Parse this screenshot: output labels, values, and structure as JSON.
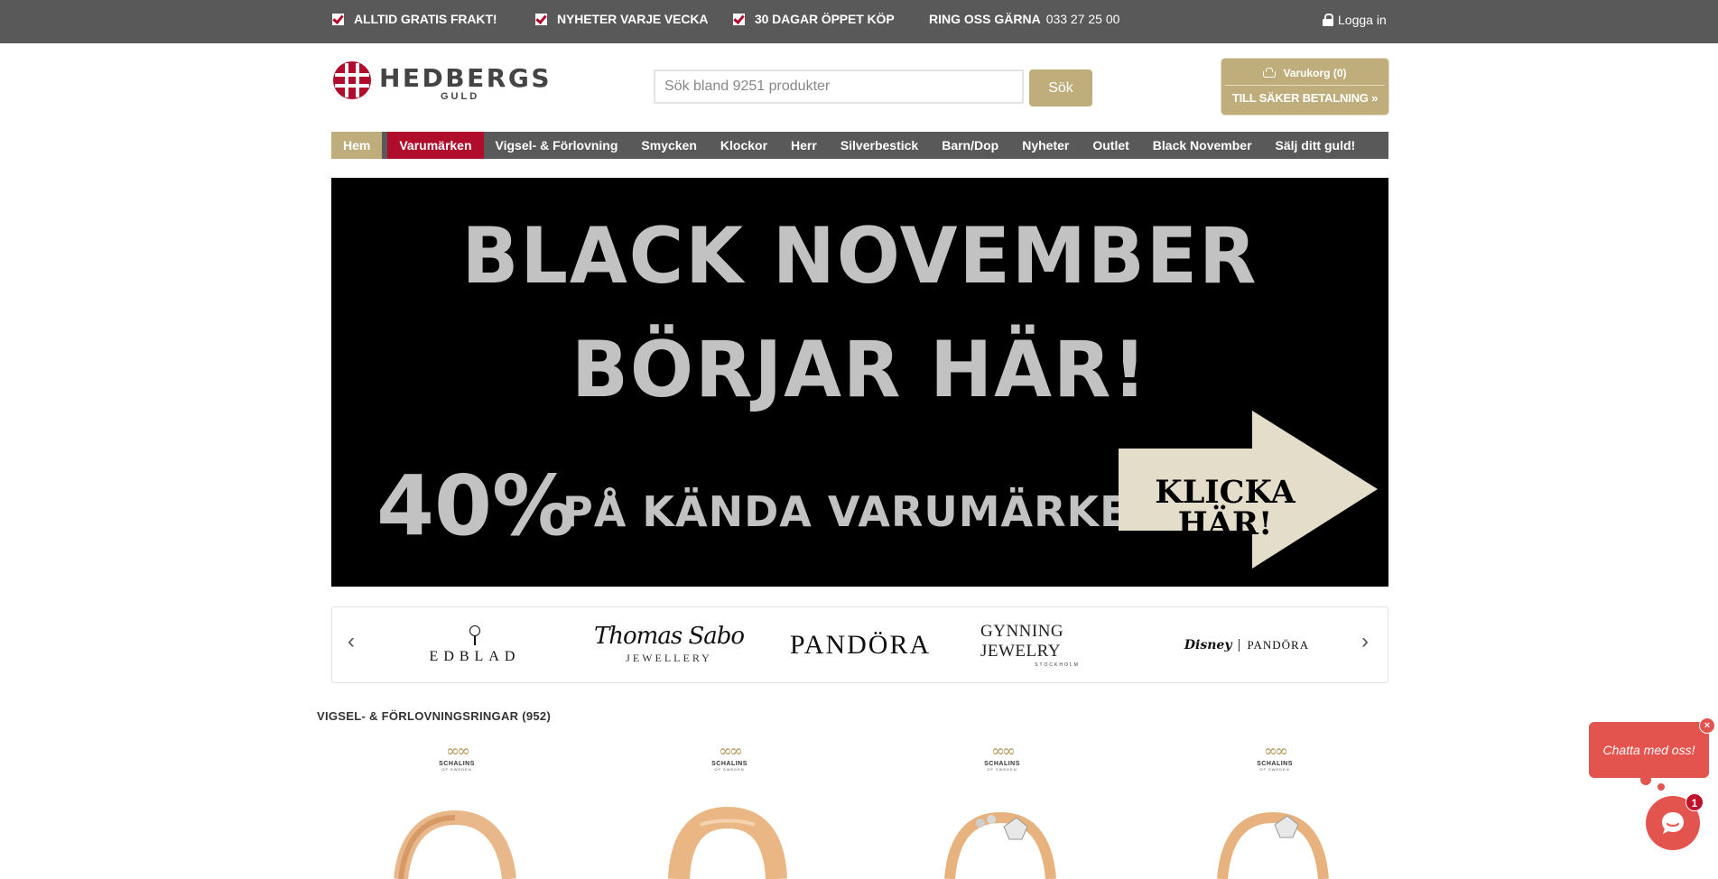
{
  "topbar": {
    "usps": [
      "ALLTID GRATIS FRAKT!",
      "NYHETER VARJE VECKA",
      "30 DAGAR ÖPPET KÖP"
    ],
    "phone_label": "RING OSS GÄRNA",
    "phone_number": "033 27 25 00",
    "login_label": "Logga in"
  },
  "logo": {
    "name": "HEDBERGS",
    "sub": "GULD"
  },
  "search": {
    "placeholder": "Sök bland 9251 produkter",
    "button_label": "Sök"
  },
  "cart": {
    "label": "Varukorg (0)",
    "checkout_label": "TILL SÄKER BETALNING »"
  },
  "nav": {
    "items": [
      "Hem",
      "Varumärken",
      "Vigsel- & Förlovning",
      "Smycken",
      "Klockor",
      "Herr",
      "Silverbestick",
      "Barn/Dop",
      "Nyheter",
      "Outlet",
      "Black November",
      "Sälj ditt guld!"
    ]
  },
  "banner": {
    "line1": "BLACK NOVEMBER",
    "line2": "BÖRJAR HÄR!",
    "percent": "40%",
    "brands_text": "PÅ KÄNDA VARUMÄRKEN",
    "cta": "KLICKA HÄR!"
  },
  "brand_carousel": {
    "prev": "‹",
    "next": "›",
    "brands": {
      "edblad": "EDBLAD",
      "thomas_sabo": "Thomas Sabo",
      "thomas_sabo_sub": "JEWELLERY",
      "pandora": "PANDÖRA",
      "gynning": "GYNNING JEWELRY",
      "gynning_sub": "STOCKHOLM",
      "disney": "Disney",
      "disney_pandora": "PANDÖRA"
    }
  },
  "section": {
    "title": "VIGSEL- & FÖRLOVNINGSRINGAR (952)"
  },
  "products": [
    {
      "brand": "SCHALINS",
      "brand_sub": "OF SWEDEN"
    },
    {
      "brand": "SCHALINS",
      "brand_sub": "OF SWEDEN"
    },
    {
      "brand": "SCHALINS",
      "brand_sub": "OF SWEDEN"
    },
    {
      "brand": "SCHALINS",
      "brand_sub": "OF SWEDEN"
    }
  ],
  "chat": {
    "bubble_text": "Chatta med oss!",
    "close": "×",
    "badge": "1"
  },
  "colors": {
    "topbar": "#595959",
    "gold": "#bfae7c",
    "red": "#b00d2d",
    "chat": "#e4544f"
  }
}
